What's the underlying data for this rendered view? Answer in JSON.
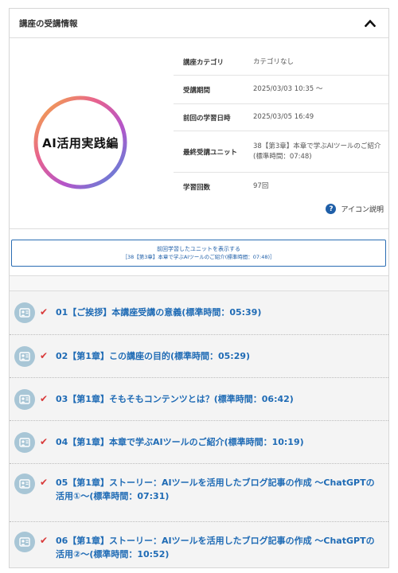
{
  "header": {
    "title": "講座の受講情報"
  },
  "course": {
    "badge": "AI活用実践編"
  },
  "info_rows": [
    {
      "label": "講座カテゴリ",
      "value": "カテゴリなし"
    },
    {
      "label": "受講期間",
      "value": "2025/03/03 10:35 ～"
    },
    {
      "label": "前回の学習日時",
      "value": "2025/03/05 16:49"
    },
    {
      "label": "最終受講ユニット",
      "value": "38【第3章】本章で学ぶAIツールのご紹介(標準時間：07:48)"
    },
    {
      "label": "学習回数",
      "value": "97回"
    }
  ],
  "help": {
    "label": "アイコン説明"
  },
  "resume": {
    "main": "前回学習したユニットを表示する",
    "sub": "［38【第3章】本章で学ぶAIツールのご紹介(標準時間：07:48)］"
  },
  "units": [
    {
      "title": "01【ご挨拶】本講座受講の意義(標準時間：05:39)"
    },
    {
      "title": "02【第1章】この講座の目的(標準時間：05:29)"
    },
    {
      "title": "03【第1章】そもそもコンテンツとは？(標準時間：06:42)"
    },
    {
      "title": "04【第1章】本章で学ぶAIツールのご紹介(標準時間：10:19)"
    },
    {
      "title": "05【第1章】ストーリー：AIツールを活用したブログ記事の作成 ～ChatGPTの活用①～(標準時間：07:31)"
    },
    {
      "title": "06【第1章】ストーリー：AIツールを活用したブログ記事の作成 ～ChatGPTの活用②～(標準時間：10:52)"
    }
  ],
  "colors": {
    "accent": "#1f6bb5",
    "check": "#d93a3a",
    "unit_icon": "#a8c6d6"
  }
}
